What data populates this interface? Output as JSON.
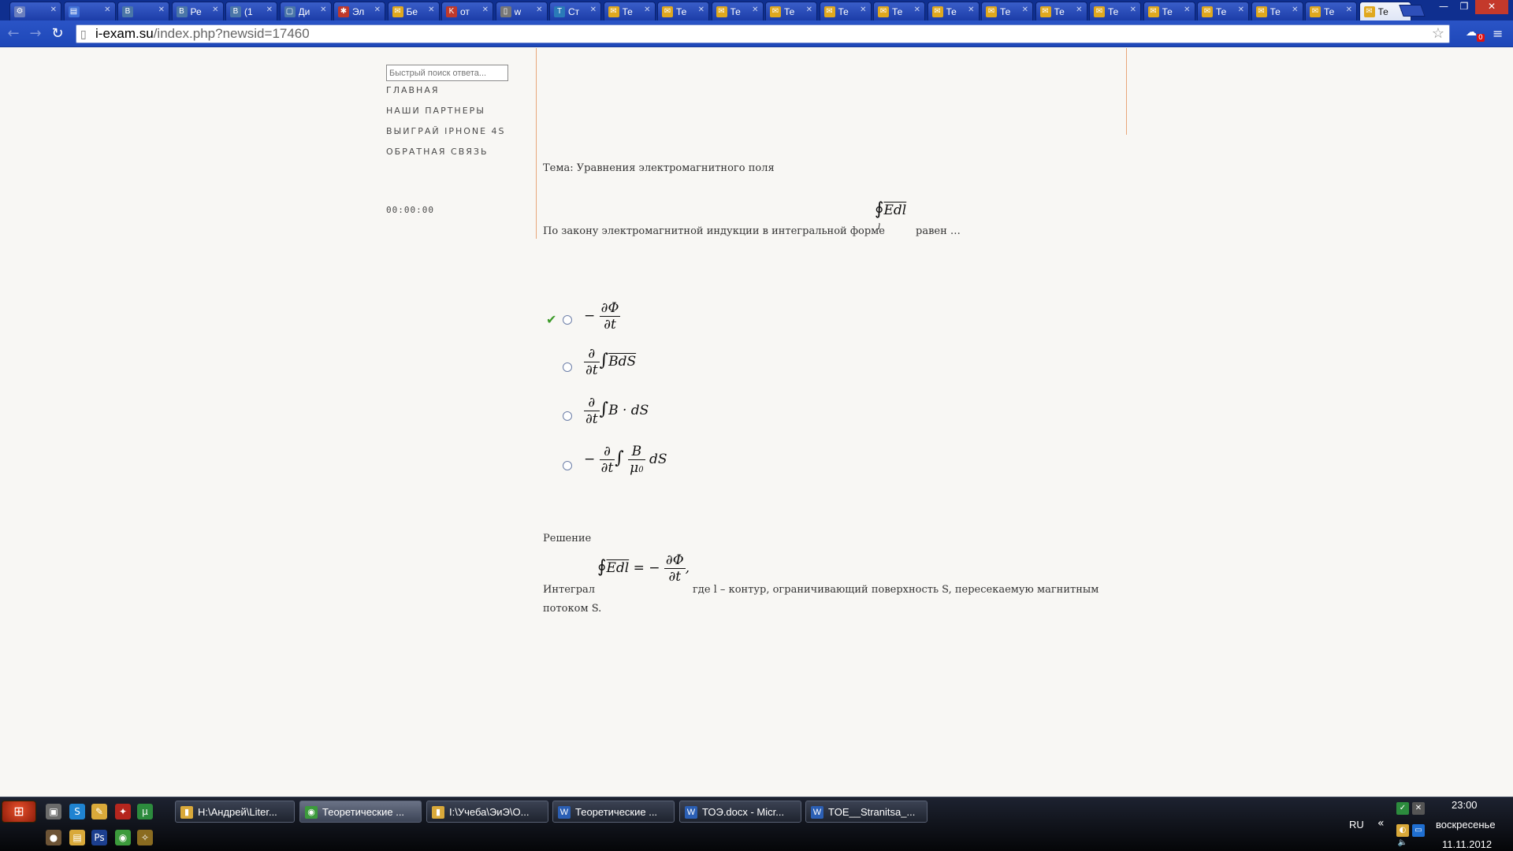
{
  "tabs": [
    {
      "label": "",
      "icon": "settings-icon",
      "color": "#6b7fbf"
    },
    {
      "label": "",
      "icon": "document-icon",
      "color": "#3f6fd6"
    },
    {
      "label": "",
      "icon": "vk-icon",
      "color": "#4a76a8"
    },
    {
      "label": "Ре",
      "icon": "vk-icon",
      "color": "#4a76a8"
    },
    {
      "label": "(1",
      "icon": "vk-icon",
      "color": "#4a76a8"
    },
    {
      "label": "Ди",
      "icon": "chat-icon",
      "color": "#4a76a8"
    },
    {
      "label": "Эл",
      "icon": "bug-icon",
      "color": "#c0392b"
    },
    {
      "label": "Бе",
      "icon": "mail-icon",
      "color": "#e0a81e"
    },
    {
      "label": "от",
      "icon": "k-icon",
      "color": "#c0392b"
    },
    {
      "label": "w",
      "icon": "page-icon",
      "color": "#777777"
    },
    {
      "label": "Ст",
      "icon": "t-icon",
      "color": "#2a7ab8"
    },
    {
      "label": "Те",
      "icon": "mail-icon",
      "color": "#e0a81e"
    },
    {
      "label": "Те",
      "icon": "mail-icon",
      "color": "#e0a81e"
    },
    {
      "label": "Те",
      "icon": "mail-icon",
      "color": "#e0a81e"
    },
    {
      "label": "Те",
      "icon": "mail-icon",
      "color": "#e0a81e"
    },
    {
      "label": "Те",
      "icon": "mail-icon",
      "color": "#e0a81e"
    },
    {
      "label": "Те",
      "icon": "mail-icon",
      "color": "#e0a81e"
    },
    {
      "label": "Те",
      "icon": "mail-icon",
      "color": "#e0a81e"
    },
    {
      "label": "Те",
      "icon": "mail-icon",
      "color": "#e0a81e"
    },
    {
      "label": "Те",
      "icon": "mail-icon",
      "color": "#e0a81e"
    },
    {
      "label": "Те",
      "icon": "mail-icon",
      "color": "#e0a81e"
    },
    {
      "label": "Те",
      "icon": "mail-icon",
      "color": "#e0a81e"
    },
    {
      "label": "Те",
      "icon": "mail-icon",
      "color": "#e0a81e"
    },
    {
      "label": "Те",
      "icon": "mail-icon",
      "color": "#e0a81e"
    },
    {
      "label": "Те",
      "icon": "mail-icon",
      "color": "#e0a81e"
    },
    {
      "label": "Те",
      "icon": "mail-icon",
      "color": "#e0a81e"
    }
  ],
  "active_tab_index": 25,
  "address": {
    "host": "i-exam.su",
    "path": "/index.php?newsid=17460"
  },
  "extension_badge": "0",
  "sidebar": {
    "search_placeholder": "Быстрый поиск ответа...",
    "links": [
      "ГЛАВНАЯ",
      "НАШИ ПАРТНЕРЫ",
      "ВЫИГРАЙ IPHONE 4S",
      "ОБРАТНАЯ СВЯЗЬ"
    ],
    "timer": "00:00:00"
  },
  "question": {
    "topic": "Тема: Уравнения электромагнитного поля",
    "text_before": "По закону электромагнитной индукции в интегральной форме",
    "text_after": "равен …",
    "integral": {
      "symbol": "∮",
      "body": "Edl",
      "limit": "l"
    },
    "options": [
      {
        "sign": "−",
        "num": "∂Φ",
        "den": "∂t",
        "tail": "",
        "correct": true
      },
      {
        "sign": "",
        "num": "∂",
        "den": "∂t",
        "tail": "BdS",
        "correct": false
      },
      {
        "sign": "",
        "num": "∂",
        "den": "∂t",
        "tail": "B · dS",
        "correct": false
      },
      {
        "sign": "−",
        "num": "∂",
        "den": "∂t",
        "tail": "dS",
        "correct": false
      }
    ]
  },
  "solution": {
    "heading": "Решение",
    "prefix": "Интеграл",
    "rhs_sign": "= −",
    "rhs_num": "∂Φ",
    "rhs_den": "∂t",
    "line1": "где l – контур, ограничивающий поверхность S, пересекаемую магнитным",
    "line2": "потоком S."
  },
  "taskbar": {
    "tasks": [
      {
        "label": "H:\\Андрей\\Liter...",
        "icon": "folder-icon",
        "color": "#d9a93a"
      },
      {
        "label": "Теоретические ...",
        "icon": "chrome-icon",
        "color": "#3c9b3c"
      },
      {
        "label": "I:\\Учеба\\ЭиЭ\\О...",
        "icon": "folder-icon",
        "color": "#d9a93a"
      },
      {
        "label": "Теоретические ...",
        "icon": "word-icon",
        "color": "#2b5fb4"
      },
      {
        "label": "ТОЭ.docx - Micr...",
        "icon": "word-icon",
        "color": "#2b5fb4"
      },
      {
        "label": "TOE__Stranitsa_...",
        "icon": "word-icon",
        "color": "#2b5fb4"
      }
    ],
    "active_task_index": 1,
    "language": "RU",
    "time": "23:00",
    "day": "воскресенье",
    "date": "11.11.2012"
  }
}
